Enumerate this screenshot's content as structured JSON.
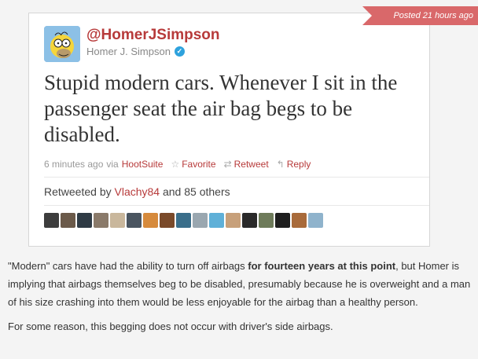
{
  "ribbon": {
    "text": "Posted 21 hours ago"
  },
  "tweet": {
    "handle": "@HomerJSimpson",
    "display_name": "Homer J. Simpson",
    "verified_mark": "✓",
    "text": "Stupid modern cars. Whenever I sit in the passenger seat the air bag begs to be disabled.",
    "time": "6 minutes ago",
    "via_label": "via",
    "source": "HootSuite",
    "favorite_label": "Favorite",
    "retweet_label": "Retweet",
    "reply_label": "Reply",
    "retweeted_by_label": "Retweeted by",
    "retweeted_by_user": "Vlachy84",
    "retweeted_others": "and 85 others",
    "retweeter_avatar_colors": [
      "#3d3d3d",
      "#6b5a4a",
      "#2f3b45",
      "#8a7a6a",
      "#c9b79c",
      "#4a5560",
      "#d68a3c",
      "#7a4a2a",
      "#3a6e8a",
      "#9aa7b0",
      "#5fb0d8",
      "#c7a07a",
      "#2a2a2a",
      "#6e7b5a",
      "#1f1f1f",
      "#a86a3a",
      "#8fb3cc"
    ]
  },
  "article": {
    "p1_a": "\"Modern\" cars have had the ability to turn off airbags ",
    "p1_bold": "for fourteen years at this point",
    "p1_b": ", but Homer is implying that airbags themselves beg to be disabled, presumably because he is overweight and a man of his size crashing into them would be less enjoyable for the airbag than a healthy person.",
    "p2": "For some reason, this begging does not occur with driver's side airbags."
  }
}
